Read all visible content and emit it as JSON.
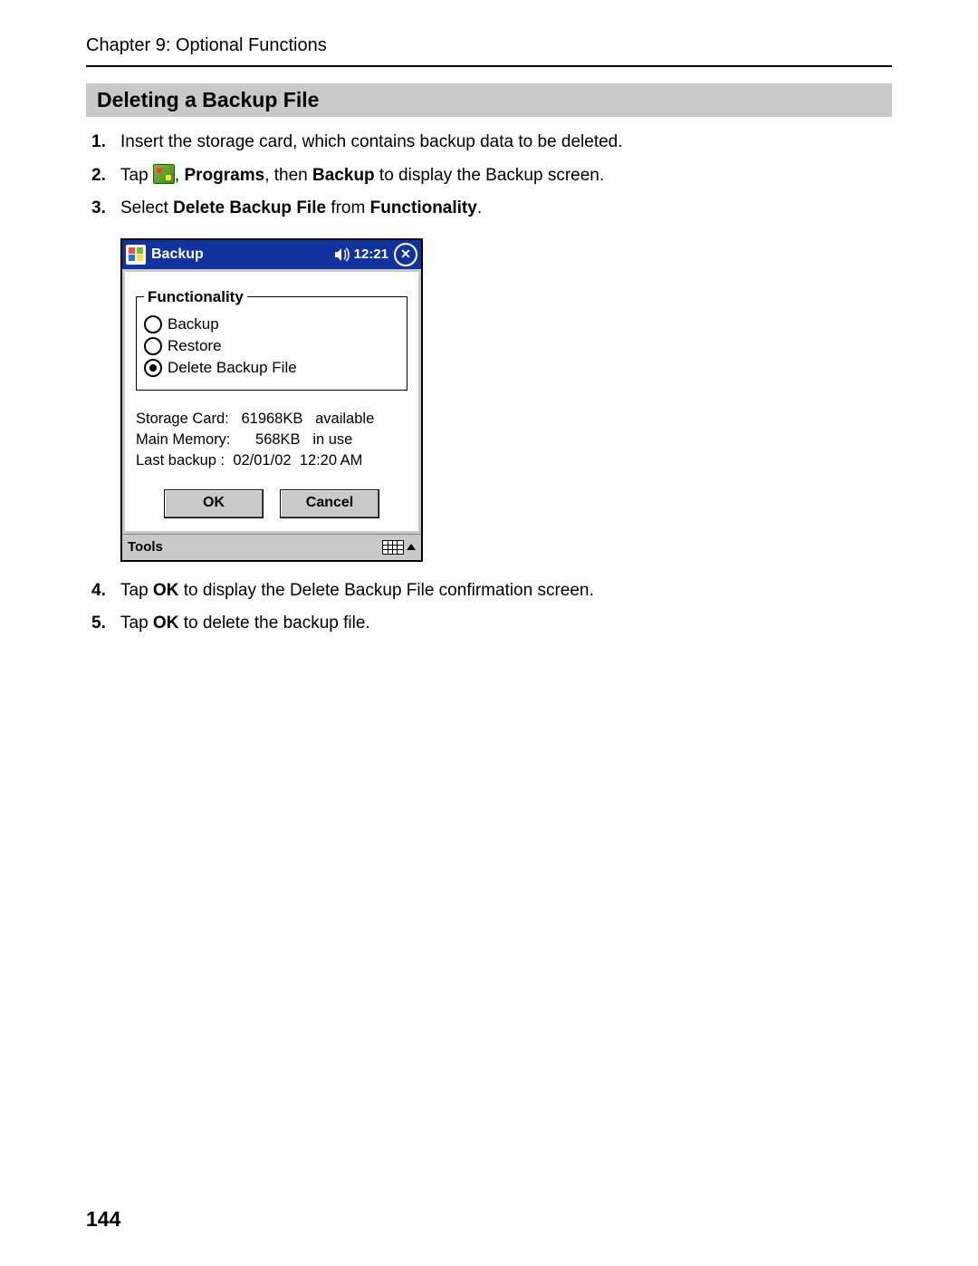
{
  "chapter": "Chapter 9: Optional Functions",
  "section_title": "Deleting a Backup File",
  "page_number": "144",
  "steps": {
    "s1": {
      "num": "1.",
      "text": "Insert the storage card, which contains backup data to be deleted."
    },
    "s2": {
      "num": "2.",
      "pre": "Tap ",
      "mid1": ", ",
      "b1": "Programs",
      "mid2": ", then ",
      "b2": "Backup",
      "post": " to display the Backup screen."
    },
    "s3": {
      "num": "3.",
      "pre": "Select ",
      "b1": "Delete Backup File",
      "mid": " from ",
      "b2": "Functionality",
      "post": "."
    },
    "s4": {
      "num": "4.",
      "pre": "Tap ",
      "b1": "OK",
      "post": " to display the Delete Backup File confirmation screen."
    },
    "s5": {
      "num": "5.",
      "pre": "Tap ",
      "b1": "OK",
      "post": " to delete the backup file."
    }
  },
  "device": {
    "title": "Backup",
    "time": "12:21",
    "fieldset_legend": "Functionality",
    "options": {
      "backup": "Backup",
      "restore": "Restore",
      "delete": "Delete Backup File"
    },
    "info": {
      "l1": "Storage Card:   61968KB   available",
      "l2": "Main Memory:      568KB   in use",
      "l3": "Last backup :  02/01/02  12:20 AM"
    },
    "buttons": {
      "ok": "OK",
      "cancel": "Cancel"
    },
    "bottom": {
      "tools": "Tools"
    }
  }
}
